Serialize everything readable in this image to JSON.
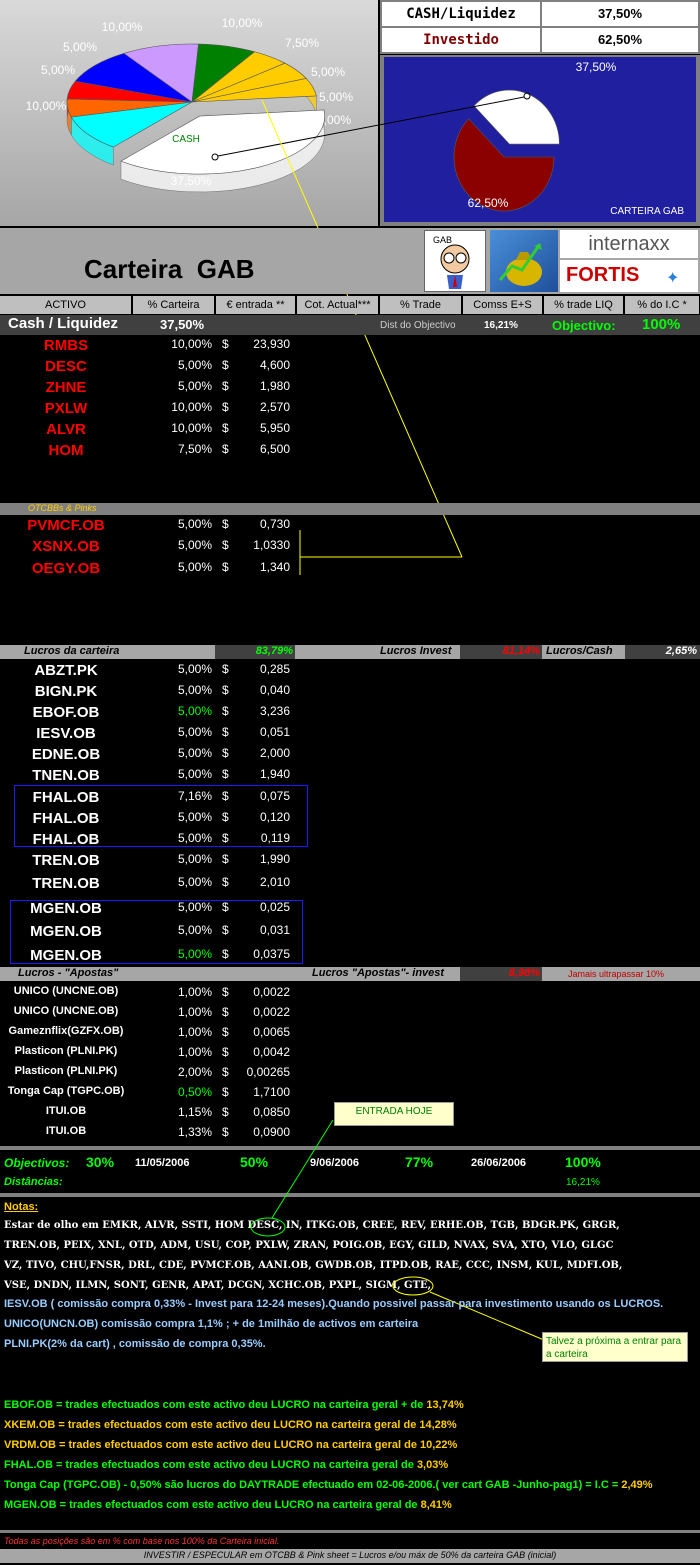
{
  "chart_data": [
    {
      "type": "pie",
      "title": "",
      "slices": [
        {
          "label": "CASH",
          "value": 37.5,
          "color": "#ffffff"
        },
        {
          "label": "RMBS",
          "value": 10.0,
          "color": "#00ffff"
        },
        {
          "label": "DESC",
          "value": 5.0,
          "color": "#ff6600"
        },
        {
          "label": "ZHNE",
          "value": 5.0,
          "color": "#ff0000"
        },
        {
          "label": "PXLW",
          "value": 10.0,
          "color": "#0000ff"
        },
        {
          "label": "ALVR",
          "value": 10.0,
          "color": "#cc99ff"
        },
        {
          "label": "HOM",
          "value": 7.5,
          "color": "#008000"
        },
        {
          "label": "PVMCF.OB",
          "value": 5.0,
          "color": "#ffcc00"
        },
        {
          "label": "XSNX.OB",
          "value": 5.0,
          "color": "#ffcc00"
        },
        {
          "label": "OEGY.OB",
          "value": 5.0,
          "color": "#ffcc00"
        }
      ],
      "slice_labels": [
        "37,50%",
        "10,00%",
        "5,00%",
        "5,00%",
        "10,00%",
        "10,00%",
        "7,50%",
        "5,00%",
        "5,00%",
        "5,00%"
      ]
    },
    {
      "type": "pie",
      "title": "CARTEIRA GAB",
      "slices": [
        {
          "label": "CASH/Liquidez",
          "value": 37.5,
          "color": "#ffffff"
        },
        {
          "label": "Investido",
          "value": 62.5,
          "color": "#8b0000"
        }
      ],
      "slice_labels": [
        "37,50%",
        "62,50%"
      ]
    }
  ],
  "pie_cash_label": "CASH",
  "summary": {
    "cash_label": "CASH/Liquidez",
    "cash_value": "37,50%",
    "inv_label": "Investido",
    "inv_value": "62,50%"
  },
  "title": "Carteira  GAB",
  "logos": {
    "gab": "GAB",
    "internaxx": "internaxx",
    "fortis": "FORTIS"
  },
  "columns": [
    "ACTIVO",
    "% Carteira",
    "€  entrada **",
    "Cot. Actual***",
    "% Trade",
    "Comss E+S",
    "% trade LIQ",
    "% do I.C *"
  ],
  "cashrow": {
    "label": "Cash / Liquidez",
    "pct": "37,50%",
    "dist_label": "Dist do Objectivo",
    "dist_value": "16,21%",
    "obj_label": "Objectivo:",
    "obj_value": "100%"
  },
  "currency": "$",
  "main": [
    {
      "n": "RMBS",
      "p": "10,00%",
      "v": "23,930"
    },
    {
      "n": "DESC",
      "p": "5,00%",
      "v": "4,600"
    },
    {
      "n": "ZHNE",
      "p": "5,00%",
      "v": "1,980"
    },
    {
      "n": "PXLW",
      "p": "10,00%",
      "v": "2,570"
    },
    {
      "n": "ALVR",
      "p": "10,00%",
      "v": "5,950"
    },
    {
      "n": "HOM",
      "p": "7,50%",
      "v": "6,500"
    }
  ],
  "otc_label": "OTCBBs & Pinks",
  "otc": [
    {
      "n": "PVMCF.OB",
      "p": "5,00%",
      "v": "0,730"
    },
    {
      "n": "XSNX.OB",
      "p": "5,00%",
      "v": "1,0330"
    },
    {
      "n": "OEGY.OB",
      "p": "5,00%",
      "v": "1,340"
    }
  ],
  "lucros_bar": {
    "l1": "Lucros da carteira",
    "v1": "83,79%",
    "l2": "Lucros Invest",
    "v2": "81,14%",
    "l3": "Lucros/Cash",
    "v3": "2,65%"
  },
  "lucros": [
    {
      "n": "ABZT.PK",
      "p": "5,00%",
      "v": "0,285"
    },
    {
      "n": "BIGN.PK",
      "p": "5,00%",
      "v": "0,040"
    },
    {
      "n": "EBOF.OB",
      "p": "5,00%",
      "v": "3,236"
    },
    {
      "n": "IESV.OB",
      "p": "5,00%",
      "v": "0,051"
    },
    {
      "n": "EDNE.OB",
      "p": "5,00%",
      "v": "2,000"
    },
    {
      "n": "TNEN.OB",
      "p": "5,00%",
      "v": "1,940"
    },
    {
      "n": "FHAL.OB",
      "p": "7,16%",
      "v": "0,075"
    },
    {
      "n": "FHAL.OB",
      "p": "5,00%",
      "v": "0,120"
    },
    {
      "n": "FHAL.OB",
      "p": "5,00%",
      "v": "0,119"
    },
    {
      "n": "TREN.OB",
      "p": "5,00%",
      "v": "1,990"
    },
    {
      "n": "TREN.OB",
      "p": "5,00%",
      "v": "2,010"
    },
    {
      "n": "MGEN.OB",
      "p": "5,00%",
      "v": "0,025"
    },
    {
      "n": "MGEN.OB",
      "p": "5,00%",
      "v": "0,031"
    },
    {
      "n": "MGEN.OB",
      "p": "5,00%",
      "v": "0,0375"
    }
  ],
  "apostas_bar": {
    "l1": "Lucros - \"Apostas\"",
    "l2": "Lucros \"Apostas\"- invest",
    "v2": "8,98%",
    "l3": "Jamais ultrapassar 10%"
  },
  "apostas": [
    {
      "n": "UNICO (UNCNE.OB)",
      "p": "1,00%",
      "v": "0,0022"
    },
    {
      "n": "UNICO (UNCNE.OB)",
      "p": "1,00%",
      "v": "0,0022"
    },
    {
      "n": "Gameznflix(GZFX.OB)",
      "p": "1,00%",
      "v": "0,0065"
    },
    {
      "n": "Plasticon (PLNI.PK)",
      "p": "1,00%",
      "v": "0,0042"
    },
    {
      "n": "Plasticon (PLNI.PK)",
      "p": "2,00%",
      "v": "0,00265"
    },
    {
      "n": "Tonga Cap (TGPC.OB)",
      "p": "0,50%",
      "v": "1,7100"
    },
    {
      "n": "ITUI.OB",
      "p": "1,15%",
      "v": "0,0850"
    },
    {
      "n": "ITUI.OB",
      "p": "1,33%",
      "v": "0,0900"
    }
  ],
  "entrada_hoje": "ENTRADA HOJE",
  "objectivos": {
    "label": "Objectivos:",
    "a": "30%",
    "ad": "11/05/2006",
    "b": "50%",
    "bd": "9/06/2006",
    "c": "77%",
    "cd": "26/06/2006",
    "d": "100%",
    "dist_label": "Distâncias:",
    "dist": "16,21%"
  },
  "notas_label": "Notas:",
  "watch": [
    "Estar de olho em   EMKR, ALVR, SSTI, HOM  DESC, IN, ITKG.OB, CREE, REV, ERHE.OB, TGB, BDGR.PK, GRGR,",
    "TREN.OB, PEIX, XNL, OTD, ADM, USU, COP, PXLW, ZRAN, POIG.OB, EGY, GILD, NVAX, SVA, XTO, VLO, GLGC",
    "VZ, TIVO, CHU,FNSR, DRL, CDE, PVMCF.OB, AANI.OB, GWDB.OB, ITPD.OB, RAE, CCC, INSM, KUL, MDFI.OB,",
    "VSE, DNDN, ILMN, SONT, GENR, APAT, DCGN, XCHC.OB, PXPL, SIGM, GTE,"
  ],
  "info": [
    "IESV.OB ( comissão compra 0,33% - Invest para 12-24 meses).Quando possivel passar para investimento  usando os LUCROS.",
    "UNICO(UNCN.OB) comissão compra 1,1% ; + de 1milhão de activos em carteira",
    "PLNI.PK(2% da cart) , comissão de compra 0,35%."
  ],
  "talvez": "Talvez a próxima a entrar para a carteira",
  "trades": [
    {
      "t": "EBOF.OB = trades efectuados com este activo  deu LUCRO na carteira geral + de ",
      "v": "13,74%"
    },
    {
      "t": "XKEM.OB = trades efectuados com este activo  deu LUCRO na carteira geral de ",
      "v": "14,28%"
    },
    {
      "t": "VRDM.OB = trades efectuados com este activo  deu LUCRO na carteira geral de ",
      "v": "10,22%"
    },
    {
      "t": "FHAL.OB = trades efectuados com este activo  deu LUCRO na carteira geral de ",
      "v": "3,03%"
    },
    {
      "t": "Tonga Cap (TGPC.OB) -  0,50% são lucros  do DAYTRADE efectuado em 02-06-2006.( ver cart GAB -Junho-pag1) = I.C = ",
      "v": "2,49%"
    },
    {
      "t": "MGEN.OB = trades efectuados com este activo  deu LUCRO na carteira geral de ",
      "v": "8,41%"
    }
  ],
  "footer1": "Todas as posições são em % com base nos 100% da Carteira inicial.",
  "footer2": "INVESTIR / ESPECULAR em OTCBB & Pink sheet  = Lucros e/ou máx de 50% da carteira GAB (inicial)"
}
